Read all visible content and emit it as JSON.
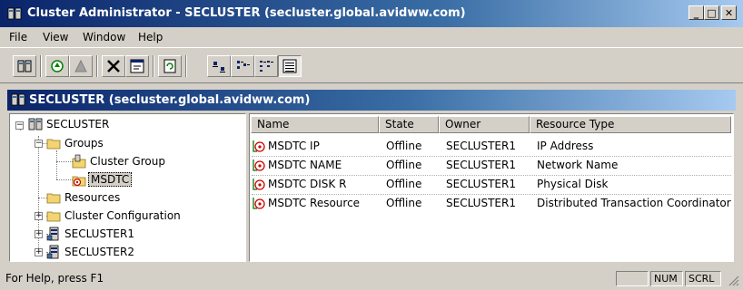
{
  "window": {
    "title": "Cluster Administrator - SECLUSTER (secluster.global.avidww.com)",
    "controls": {
      "minimize": "_",
      "maximize": "□",
      "close": "✕"
    }
  },
  "menu": [
    {
      "label": "File"
    },
    {
      "label": "View"
    },
    {
      "label": "Window"
    },
    {
      "label": "Help"
    }
  ],
  "toolbar": {
    "buttons": [
      {
        "icon": "open-connection-icon"
      },
      {
        "icon": "bring-online-icon"
      },
      {
        "icon": "take-offline-icon"
      },
      {
        "icon": "delete-icon"
      },
      {
        "icon": "properties-icon"
      },
      {
        "icon": "refresh-icon"
      },
      {
        "icon": "large-icons-icon"
      },
      {
        "icon": "small-icons-icon"
      },
      {
        "icon": "list-view-icon"
      },
      {
        "icon": "details-view-icon"
      }
    ]
  },
  "child_window": {
    "title": "SECLUSTER (secluster.global.avidww.com)"
  },
  "tree": {
    "root": "SECLUSTER",
    "groups": "Groups",
    "cluster_group": "Cluster Group",
    "msdtc": "MSDTC",
    "resources": "Resources",
    "cluster_configuration": "Cluster Configuration",
    "node1": "SECLUSTER1",
    "node2": "SECLUSTER2",
    "selected": "MSDTC"
  },
  "list": {
    "columns": [
      "Name",
      "State",
      "Owner",
      "Resource Type"
    ],
    "rows": [
      {
        "name": "MSDTC IP",
        "state": "Offline",
        "owner": "SECLUSTER1",
        "type": "IP Address"
      },
      {
        "name": "MSDTC NAME",
        "state": "Offline",
        "owner": "SECLUSTER1",
        "type": "Network Name"
      },
      {
        "name": "MSDTC DISK R",
        "state": "Offline",
        "owner": "SECLUSTER1",
        "type": "Physical Disk"
      },
      {
        "name": "MSDTC Resource",
        "state": "Offline",
        "owner": "SECLUSTER1",
        "type": "Distributed Transaction Coordinator"
      }
    ]
  },
  "statusbar": {
    "text": "For Help, press F1",
    "num": "NUM",
    "scrl": "SCRL"
  },
  "colors": {
    "title_active": "#0a246a",
    "title_gradient_end": "#a6caf0",
    "face": "#d4d0c8",
    "offline_icon": "#cc0000"
  }
}
